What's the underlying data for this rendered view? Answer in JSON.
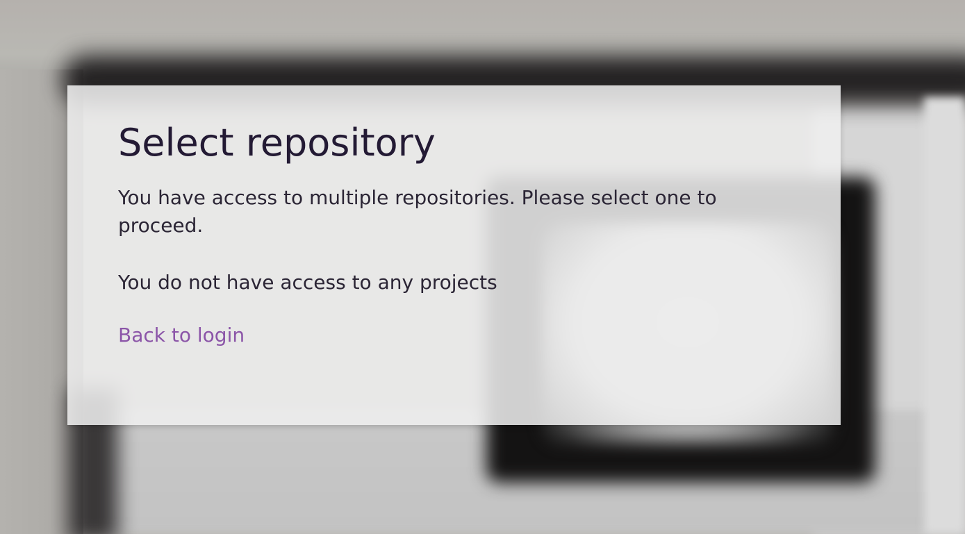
{
  "dialog": {
    "title": "Select repository",
    "description": "You have access to multiple repositories. Please select one to proceed.",
    "empty_message": "You do not have access to any projects",
    "back_link_label": "Back to login"
  },
  "colors": {
    "title": "#231a34",
    "text": "#2b2535",
    "link": "#8b55a8",
    "dialog_background": "#f0f0f0"
  }
}
